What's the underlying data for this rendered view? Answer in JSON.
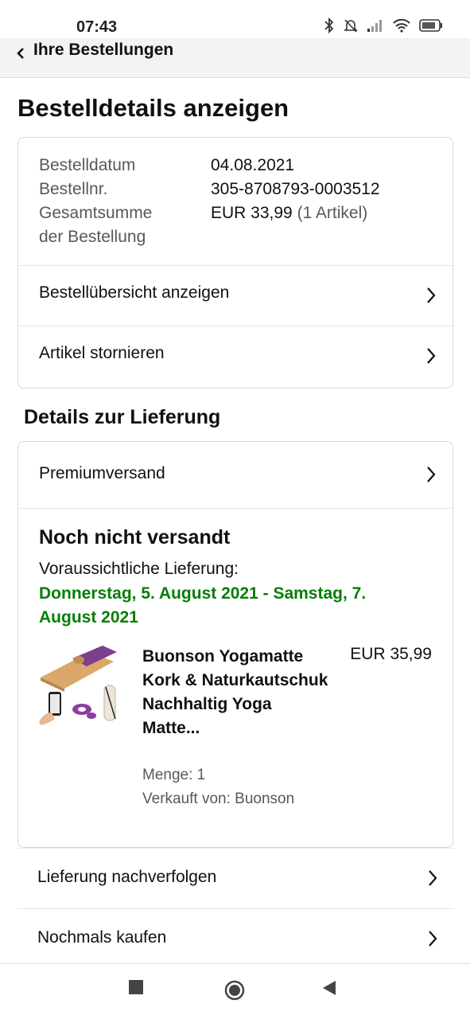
{
  "status_bar": {
    "time": "07:43"
  },
  "header": {
    "back_label": "Ihre Bestellungen"
  },
  "page": {
    "title": "Bestelldetails anzeigen"
  },
  "summary": {
    "date_label": "Bestelldatum",
    "date_value": "04.08.2021",
    "order_no_label": "Bestellnr.",
    "order_no_value": "305-8708793-0003512",
    "total_label_line1": "Gesamtsumme",
    "total_label_line2": "der Bestellung",
    "total_value": "EUR 33,99",
    "total_items": "(1 Artikel)",
    "rows": [
      {
        "label": "Bestellübersicht anzeigen"
      },
      {
        "label": "Artikel stornieren"
      }
    ]
  },
  "delivery": {
    "section_title": "Details zur Lieferung",
    "shipping_method": "Premiumversand",
    "status": "Noch nicht versandt",
    "estimate_label": "Voraussichtliche Lieferung:",
    "estimate_date": "Donnerstag, 5. August 2021 - Samstag, 7. August 2021",
    "product": {
      "name": "Buonson Yogamatte Kork & Naturkautschuk Nachhaltig Yoga Matte...",
      "price": "EUR 35,99",
      "quantity": "Menge: 1",
      "seller": "Verkauft von: Buonson"
    }
  },
  "actions": [
    {
      "label": "Lieferung nachverfolgen"
    },
    {
      "label": "Nochmals kaufen"
    }
  ],
  "colors": {
    "delivery_green": "#067d06",
    "header_bg": "#f3f3f3"
  }
}
